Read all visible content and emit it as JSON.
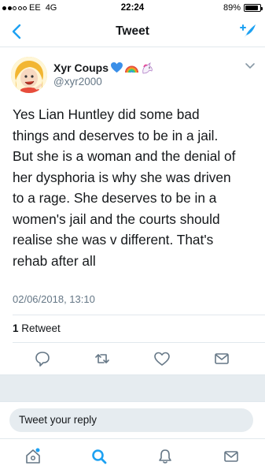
{
  "status_bar": {
    "carrier": "EE",
    "network": "4G",
    "time": "22:24",
    "battery": "89%",
    "battery_level": 0.89
  },
  "nav": {
    "title": "Tweet",
    "back_icon": "chevron-left-icon",
    "compose_icon": "compose-tweet-icon"
  },
  "tweet": {
    "author": {
      "display_name": "Xyr Coups",
      "name_emojis": [
        "blue-heart",
        "rainbow",
        "unicorn"
      ],
      "handle": "@xyr2000"
    },
    "lines": [
      "Yes Lian Huntley did some bad",
      "things and deserves to be in a jail.",
      "But she is a woman and the denial of",
      "her dysphoria is why she was driven",
      "to a rage. She deserves to be in a",
      "women's jail and the courts should",
      "realise she was v different. That's",
      "rehab after all"
    ],
    "timestamp": "02/06/2018, 13:10",
    "retweet_count": "1",
    "retweet_label": "Retweet"
  },
  "reply": {
    "placeholder": "Tweet your reply"
  },
  "colors": {
    "accent": "#1da1f2",
    "text": "#14171a",
    "secondary": "#657786",
    "divider": "#e1e8ed",
    "band": "#e6ecf0"
  }
}
